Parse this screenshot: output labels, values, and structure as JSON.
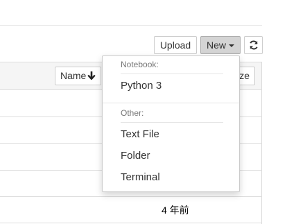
{
  "toolbar": {
    "upload_label": "Upload",
    "new_label": "New",
    "refresh_icon": "refresh-icon"
  },
  "list_header": {
    "name_label": "Name",
    "size_label": "ze",
    "sort_icon": "arrow-down-icon"
  },
  "rows": [
    {
      "modified": "4 年前"
    }
  ],
  "new_menu": {
    "notebook_header": "Notebook:",
    "python_label": "Python 3",
    "other_header": "Other:",
    "text_file_label": "Text File",
    "folder_label": "Folder",
    "terminal_label": "Terminal"
  },
  "colors": {
    "new_button_active": "#d4d4d4",
    "border": "#cccccc",
    "header_bg": "#f5f5f5"
  }
}
